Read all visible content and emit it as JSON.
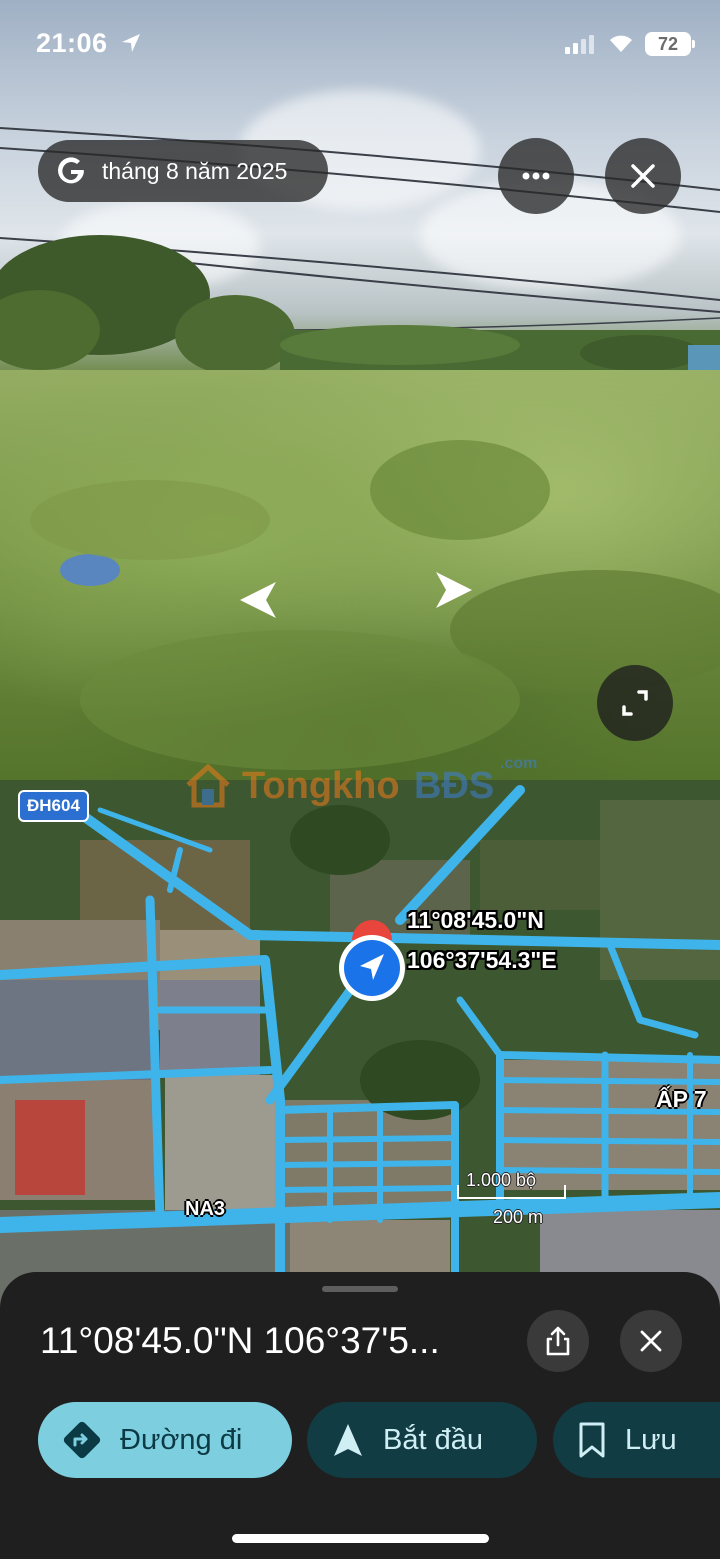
{
  "status_bar": {
    "time": "21:06",
    "battery": "72"
  },
  "streetview": {
    "date": "tháng 8 năm 2025"
  },
  "watermark": {
    "part1": "Tongkho",
    "part2": "BĐS",
    "suffix": ".com"
  },
  "map": {
    "highway_badge": "ĐH604",
    "coord_lat": "11°08'45.0\"N",
    "coord_lng": "106°37'54.3\"E",
    "area_label": "ẤP 7",
    "road_label": "NA3",
    "scale_imperial": "1.000 bộ",
    "scale_metric": "200 m"
  },
  "sheet": {
    "title": "11°08'45.0\"N 106°37'5...",
    "actions": {
      "directions": "Đường đi",
      "start": "Bắt đầu",
      "save": "Lưu"
    }
  },
  "colors": {
    "road": "#3fb4ea",
    "primary_button": "#7dcfe0",
    "secondary_button": "#123c43",
    "location_dot": "#1a73e8"
  }
}
